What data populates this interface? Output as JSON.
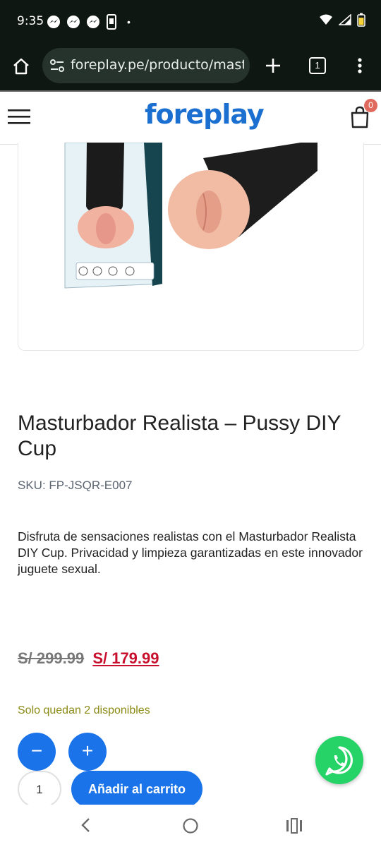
{
  "status_bar": {
    "time": "9:35",
    "dot": "•",
    "notification_icons": [
      "messenger-icon",
      "messenger-icon",
      "messenger-icon",
      "phone-icon"
    ],
    "right_icons": [
      "wifi-icon",
      "signal-icon",
      "battery-icon"
    ]
  },
  "browser": {
    "url": "foreplay.pe/producto/mastu",
    "tab_count": "1",
    "icons": [
      "home-icon",
      "site-settings-icon",
      "new-tab-icon",
      "tab-switcher-icon",
      "more-menu-icon"
    ]
  },
  "site_header": {
    "logo": "foreplay",
    "cart_count": "0",
    "icons": [
      "hamburger-menu-icon",
      "shopping-bag-icon"
    ]
  },
  "product": {
    "title": "Masturbador Realista – Pussy DIY Cup",
    "sku": "SKU: FP-JSQR-E007",
    "description": "Disfruta de sensaciones realistas con el Masturbador Realista DIY Cup. Privacidad y limpieza garantizadas en este innovador juguete sexual.",
    "old_price": "S/ 299.99",
    "new_price": "S/ 179.99",
    "stock": "Solo quedan 2 disponibles",
    "decrement": "−",
    "increment": "+",
    "quantity": "1",
    "add_to_cart": "Añadir al carrito"
  },
  "colors": {
    "accent": "#1a73e8",
    "brand_logo": "#1a6fd0",
    "sale_price": "#c8102e",
    "stock_text": "#8a8a15",
    "whatsapp": "#25d366",
    "cart_badge": "#e06a5d"
  },
  "floating": {
    "whatsapp_icon": "whatsapp-icon"
  },
  "nav_bar": {
    "icons": [
      "back-icon",
      "home-circle-icon",
      "recents-icon"
    ]
  }
}
